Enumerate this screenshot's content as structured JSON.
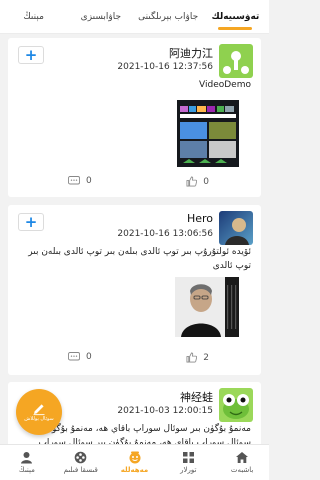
{
  "top_tabs": [
    {
      "label": "تەۋسىيەلك",
      "active": true
    },
    {
      "label": "جاۋاب بېرىلگىنى",
      "active": false
    },
    {
      "label": "جاۋابسىزى",
      "active": false
    },
    {
      "label": "مېنىڭ",
      "active": false
    }
  ],
  "posts": [
    {
      "username": "阿迪力江",
      "datetime": "2021-10-16 12:37:56",
      "text": "VideoDemo",
      "likes": "0",
      "comments": "0"
    },
    {
      "username": "Hero",
      "datetime": "2021-10-16 13:06:56",
      "text": "ئۆيدە ئولتۇرۇپ بىر توپ ئالدى بىلەن بىر توپ ئالدى بىلەن بىر توپ ئالدى",
      "likes": "2",
      "comments": "0"
    },
    {
      "username": "神经蛙",
      "datetime": "2021-10-03 12:00:15",
      "text": "مەنمۇ بۇگۈن بىر سوئال سوراپ باقاي ھە، مەنمۇ بۇگۈن بىر سوئال سوراپ باقاي ھە، مەنمۇ بۇگۈن بىر سوئال سوراپ باقاي ھە، مەنمۇ"
    }
  ],
  "fab": {
    "label": "سوئال يوللاش"
  },
  "bottom_nav": [
    {
      "label": "باشبەت",
      "icon": "home-icon",
      "active": false
    },
    {
      "label": "تورلار",
      "icon": "grid-icon",
      "active": false
    },
    {
      "label": "مەھەللە",
      "icon": "community-icon",
      "active": true
    },
    {
      "label": "قىسقا فىلىم",
      "icon": "film-reel-icon",
      "active": false
    },
    {
      "label": "مېنىڭ",
      "icon": "person-icon",
      "active": false
    }
  ],
  "colors": {
    "accent": "#f5a623",
    "plus": "#1e88e5"
  }
}
